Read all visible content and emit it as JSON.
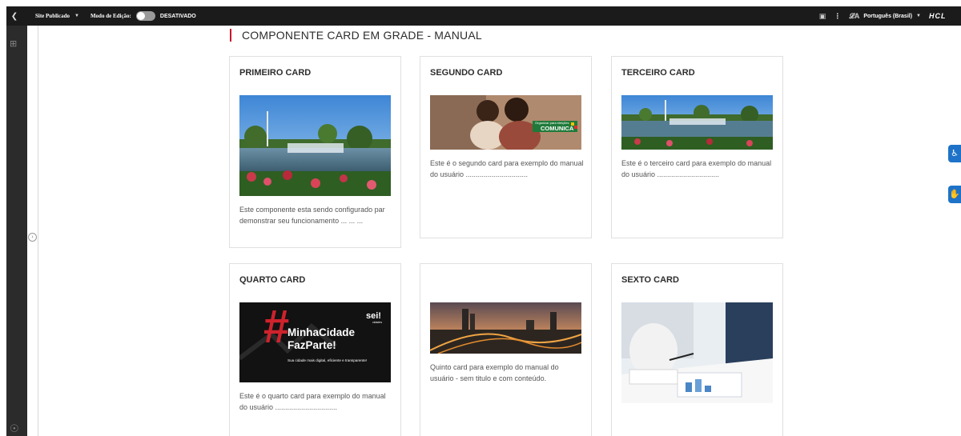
{
  "topbar": {
    "back_icon": "chevron-left-icon",
    "site_label": "Site Publicado",
    "edit_mode_label": "Modo de Edição:",
    "edit_mode_state": "DESATIVADO",
    "language": "Português (Brasil)",
    "brand": "HCL"
  },
  "page": {
    "title": "COMPONENTE CARD EM GRADE - MANUAL"
  },
  "cards": [
    {
      "title": "PRIMEIRO CARD",
      "text": "Este componente esta sendo configurado par demonstrar seu funcionamento ... ... ...",
      "image": "park-fountain-photo"
    },
    {
      "title": "SEGUNDO CARD",
      "text": "Este é o segundo card para exemplo do manual do usuário ...............................",
      "image": "family-laptop-photo",
      "image_badge": "COMUNICA",
      "image_badge_small": "Organizar para eleições"
    },
    {
      "title": "TERCEIRO CARD",
      "text": "Este é o terceiro card para exemplo do manual do usuário ...............................",
      "image": "park-fountain-photo"
    },
    {
      "title": "QUARTO CARD",
      "text": "Este é o quarto card para exemplo do manual do usuário ...............................",
      "image": "minha-cidade-banner",
      "banner_line1": "MinhaCidade",
      "banner_line2": "FazParte!",
      "banner_sub": "Sua cidade mais digital, eficiente e transparente!",
      "banner_logo": "sei!",
      "banner_logo_sub": "cidades"
    },
    {
      "title": "",
      "text": "Quinto card para exemplo do manual do usuário -  sem titulo e com conteúdo.",
      "image": "city-night-photo"
    },
    {
      "title": "SEXTO CARD",
      "text": "",
      "image": "business-charts-photo"
    }
  ],
  "colors": {
    "accent": "#c7162b",
    "topbar": "#1b1b1b",
    "float_button": "#1e73c8"
  }
}
